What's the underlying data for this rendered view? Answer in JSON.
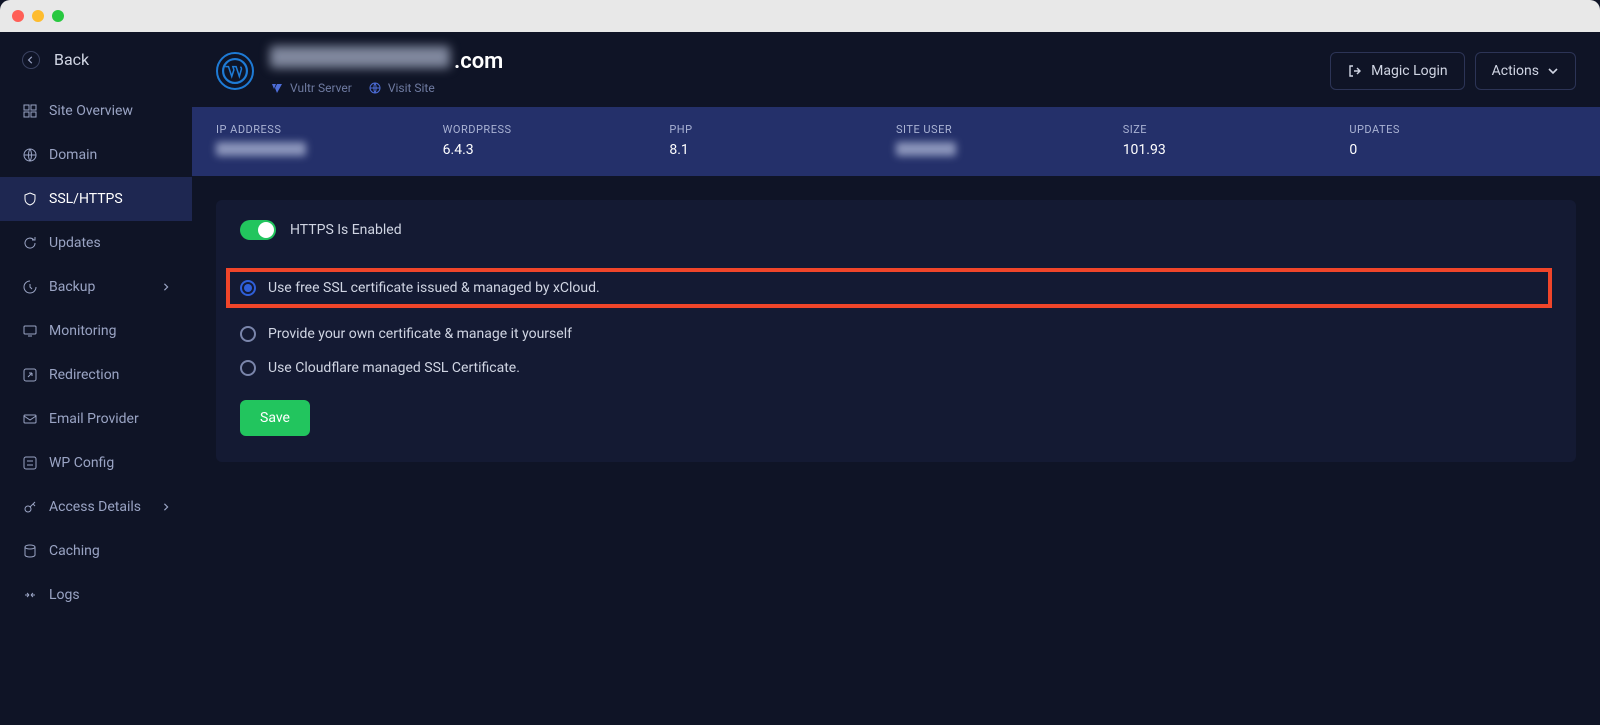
{
  "back_label": "Back",
  "sidebar": {
    "items": [
      {
        "label": "Site Overview",
        "icon": "overview"
      },
      {
        "label": "Domain",
        "icon": "globe"
      },
      {
        "label": "SSL/HTTPS",
        "icon": "shield",
        "active": true
      },
      {
        "label": "Updates",
        "icon": "refresh"
      },
      {
        "label": "Backup",
        "icon": "backup",
        "expandable": true
      },
      {
        "label": "Monitoring",
        "icon": "monitor"
      },
      {
        "label": "Redirection",
        "icon": "redirect"
      },
      {
        "label": "Email Provider",
        "icon": "mail"
      },
      {
        "label": "WP Config",
        "icon": "config"
      },
      {
        "label": "Access Details",
        "icon": "key",
        "expandable": true
      },
      {
        "label": "Caching",
        "icon": "cache"
      },
      {
        "label": "Logs",
        "icon": "logs"
      }
    ]
  },
  "header": {
    "domain_suffix": ".com",
    "server_label": "Vultr Server",
    "visit_label": "Visit Site",
    "magic_login": "Magic Login",
    "actions": "Actions"
  },
  "stats": {
    "ip_address": {
      "label": "IP ADDRESS"
    },
    "wordpress": {
      "label": "WORDPRESS",
      "value": "6.4.3"
    },
    "php": {
      "label": "PHP",
      "value": "8.1"
    },
    "site_user": {
      "label": "SITE USER"
    },
    "size": {
      "label": "SIZE",
      "value": "101.93"
    },
    "updates": {
      "label": "UPDATES",
      "value": "0"
    }
  },
  "ssl": {
    "https_enabled_label": "HTTPS Is Enabled",
    "options": [
      "Use free SSL certificate issued & managed by xCloud.",
      "Provide your own certificate & manage it yourself",
      "Use Cloudflare managed SSL Certificate."
    ],
    "save_label": "Save"
  }
}
